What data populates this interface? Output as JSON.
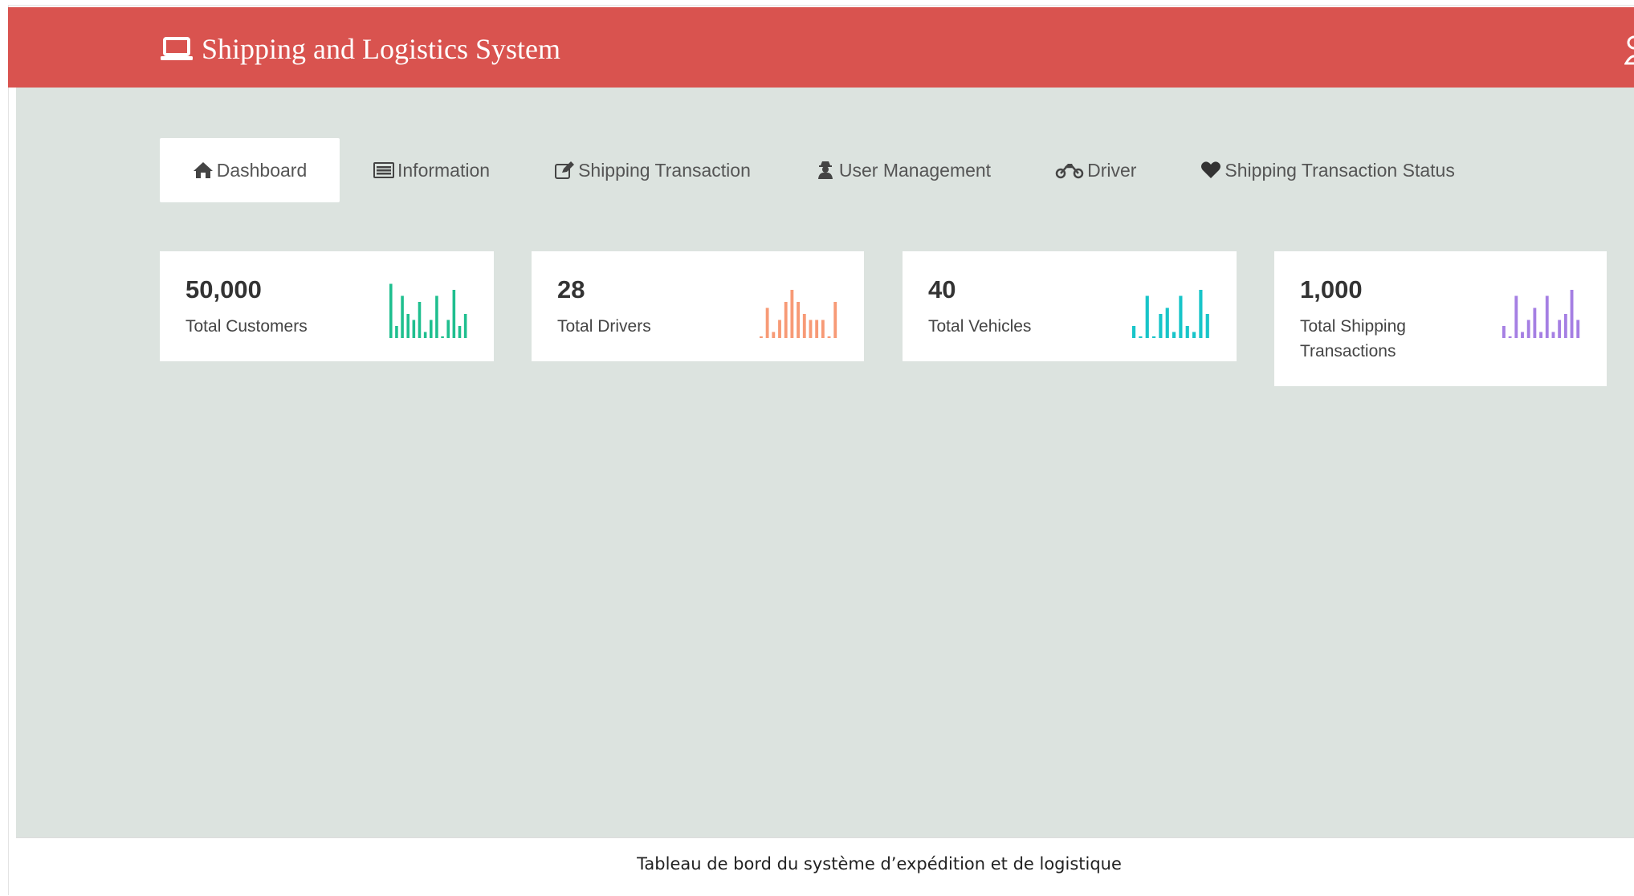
{
  "app": {
    "title": "Shipping and Logistics System",
    "brand_icon": "laptop-icon",
    "header_color": "#d9534f",
    "background_color": "#dce3df"
  },
  "nav": {
    "tabs": [
      {
        "label": "Dashboard",
        "icon": "home-icon",
        "active": true
      },
      {
        "label": "Information",
        "icon": "list-icon",
        "active": false
      },
      {
        "label": "Shipping Transaction",
        "icon": "edit-icon",
        "active": false
      },
      {
        "label": "User Management",
        "icon": "user-secret-icon",
        "active": false
      },
      {
        "label": "Driver",
        "icon": "motorcycle-icon",
        "active": false
      },
      {
        "label": "Shipping Transaction Status",
        "icon": "heart-icon",
        "active": false
      }
    ]
  },
  "cards": [
    {
      "value": "50,000",
      "label": "Total Customers",
      "color": "#1fbf8f",
      "spark": [
        9,
        2,
        7,
        4,
        3,
        6,
        1,
        3,
        7,
        0,
        3,
        8,
        2,
        4
      ]
    },
    {
      "value": "28",
      "label": "Total Drivers",
      "color": "#f79a76",
      "spark": [
        0,
        5,
        1,
        3,
        6,
        8,
        6,
        4,
        3,
        3,
        3,
        0,
        6
      ]
    },
    {
      "value": "40",
      "label": "Total Vehicles",
      "color": "#18c5c9",
      "spark": [
        2,
        0,
        7,
        0,
        4,
        5,
        1,
        7,
        2,
        1,
        8,
        4
      ]
    },
    {
      "value": "1,000",
      "label": "Total Shipping Transactions",
      "color": "#a57fe3",
      "spark": [
        2,
        0,
        7,
        1,
        3,
        5,
        1,
        7,
        1,
        3,
        4,
        8,
        3
      ]
    }
  ],
  "footer": {
    "caption": "Tableau de bord du système d’expédition et de logistique"
  }
}
